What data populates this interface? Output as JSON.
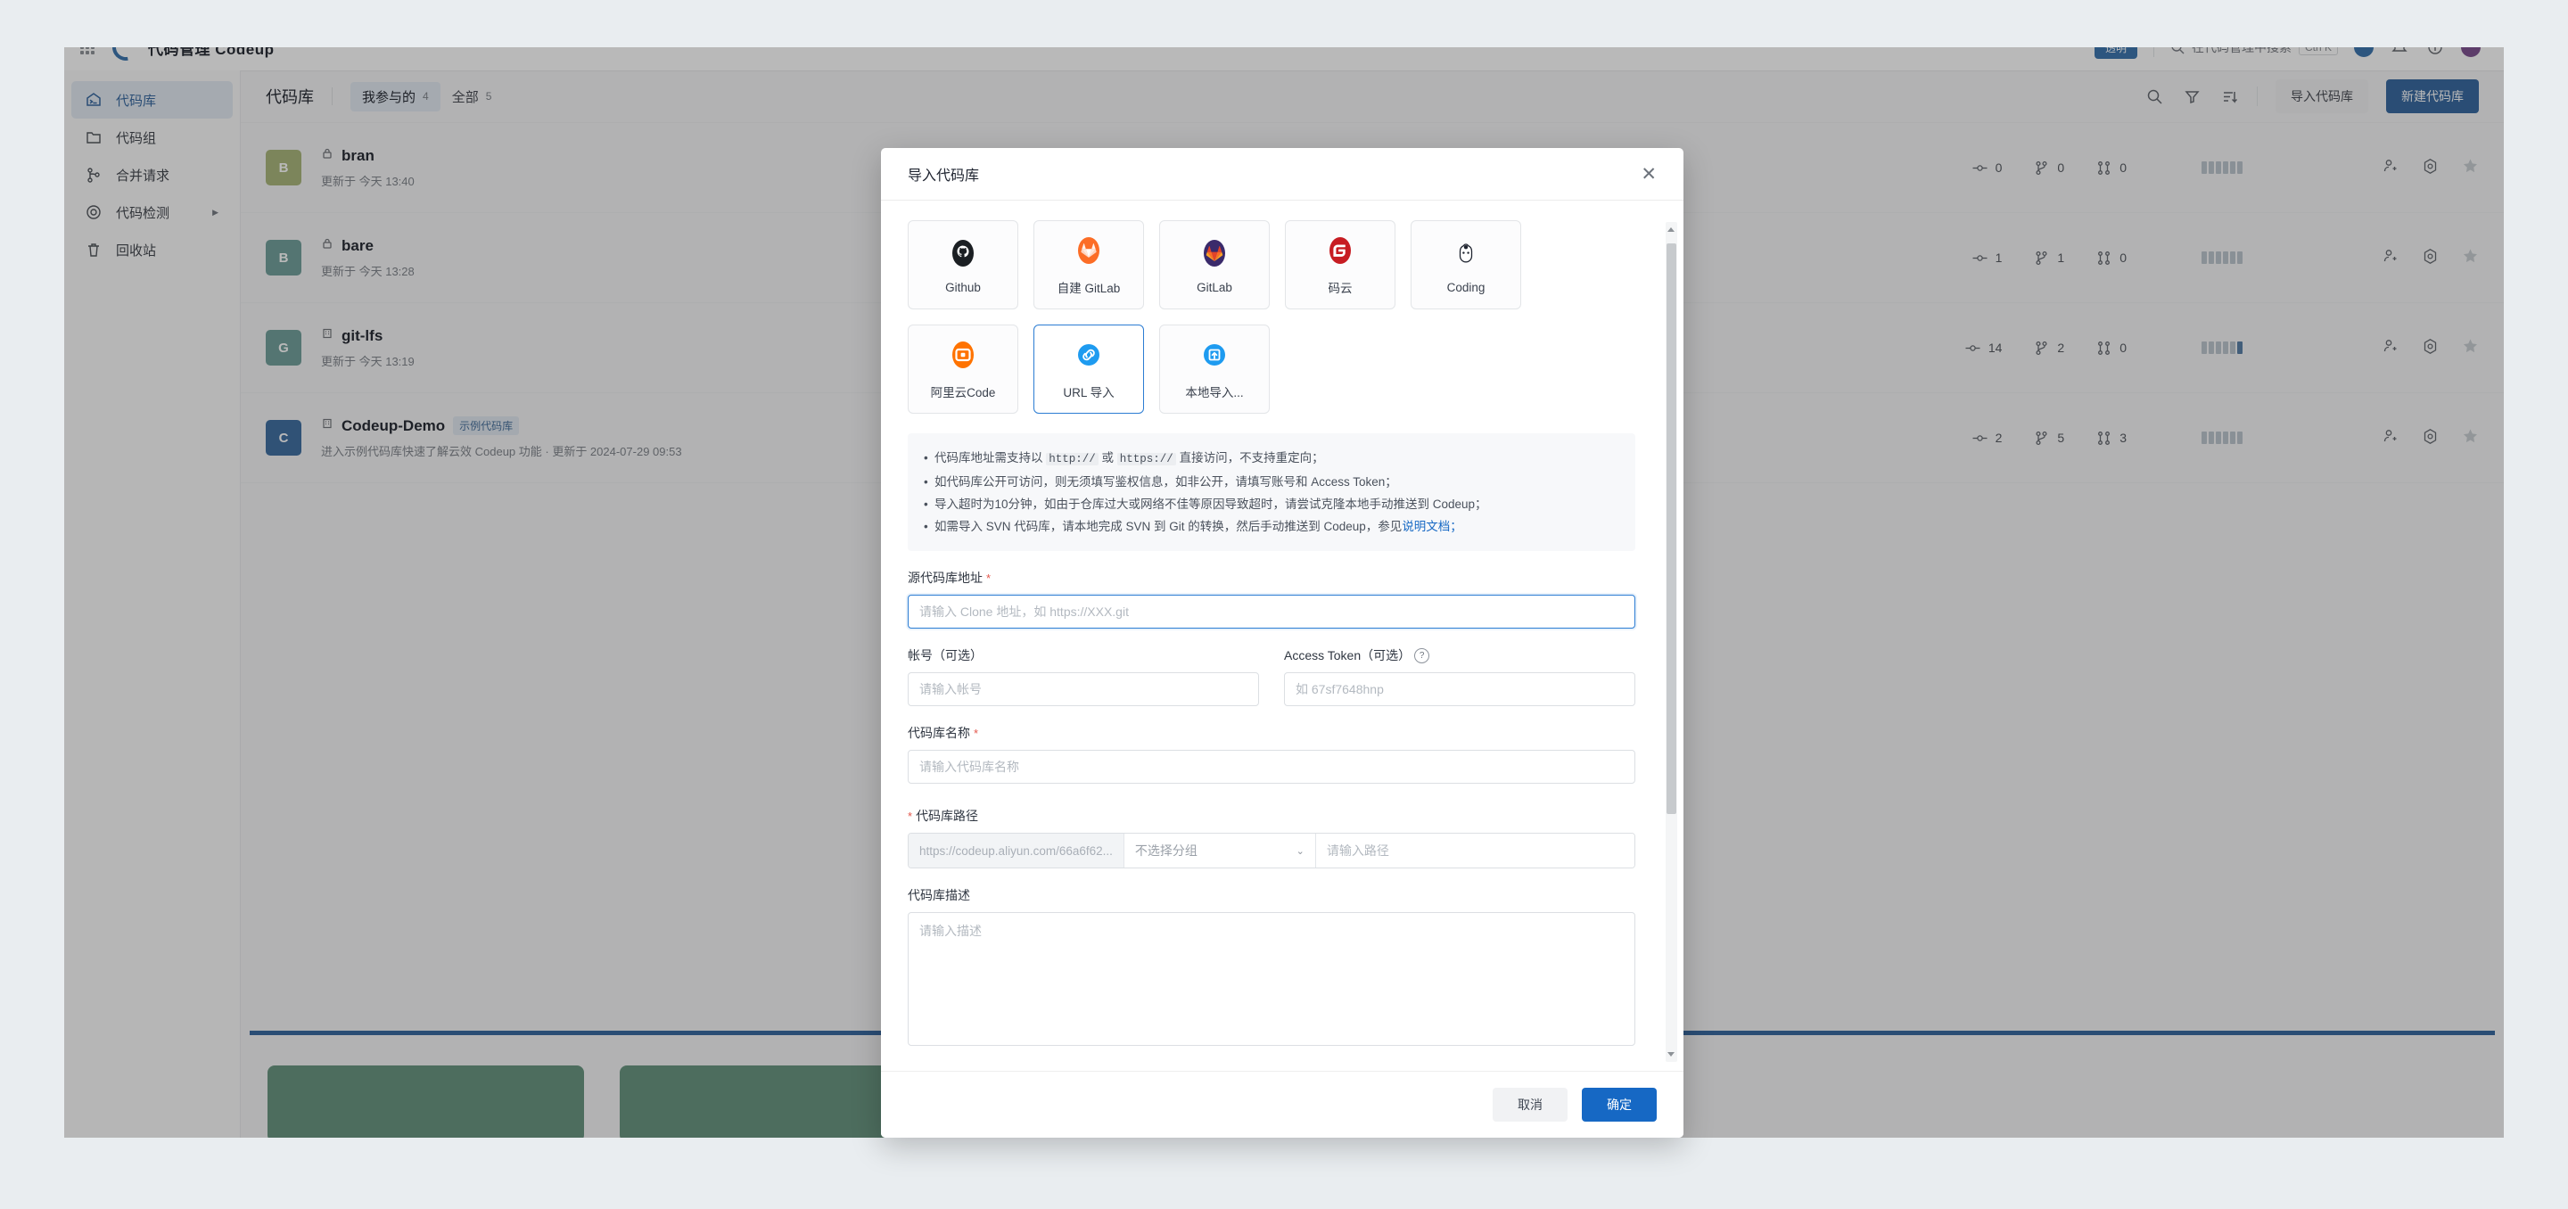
{
  "topbar": {
    "brand": "代码管理 Codeup",
    "badge": "透明",
    "search_placeholder": "在代码管理中搜索",
    "search_kbd": "Ctrl K"
  },
  "sidebar": {
    "items": [
      {
        "label": "代码库",
        "icon": "repository-icon",
        "active": true,
        "caret": false
      },
      {
        "label": "代码组",
        "icon": "folder-icon",
        "active": false,
        "caret": false
      },
      {
        "label": "合并请求",
        "icon": "merge-request-icon",
        "active": false,
        "caret": false
      },
      {
        "label": "代码检测",
        "icon": "code-scan-icon",
        "active": false,
        "caret": true
      },
      {
        "label": "回收站",
        "icon": "trash-icon",
        "active": false,
        "caret": false
      }
    ]
  },
  "content": {
    "title": "代码库",
    "tabs": [
      {
        "label": "我参与的",
        "count": "4",
        "active": true
      },
      {
        "label": "全部",
        "count": "5",
        "active": false
      }
    ],
    "toolbar": {
      "search_icon": "search-icon",
      "filter_icon": "filter-icon",
      "sort_icon": "sort-icon",
      "import_label": "导入代码库",
      "create_label": "新建代码库"
    },
    "repos": [
      {
        "initial": "B",
        "color": "#a4b957",
        "name": "bran",
        "visibility": "private",
        "tag": "",
        "sub": "更新于 今天 13:40",
        "commits": "0",
        "branches": "0",
        "mrs": "0",
        "bars": 6,
        "hi": 0
      },
      {
        "initial": "B",
        "color": "#56a49b",
        "name": "bare",
        "visibility": "private",
        "tag": "",
        "sub": "更新于 今天 13:28",
        "commits": "1",
        "branches": "1",
        "mrs": "0",
        "bars": 6,
        "hi": 0
      },
      {
        "initial": "G",
        "color": "#56a49b",
        "name": "git-lfs",
        "visibility": "internal",
        "tag": "",
        "sub": "更新于 今天 13:19",
        "commits": "14",
        "branches": "2",
        "mrs": "0",
        "bars": 6,
        "hi": 1
      },
      {
        "initial": "C",
        "color": "#1f6fc4",
        "name": "Codeup-Demo",
        "visibility": "internal",
        "tag": "示例代码库",
        "sub": "进入示例代码库快速了解云效 Codeup 功能 ·  更新于 2024-07-29 09:53",
        "commits": "2",
        "branches": "5",
        "mrs": "3",
        "bars": 6,
        "hi": 0
      }
    ]
  },
  "modal": {
    "title": "导入代码库",
    "close_icon": "close-icon",
    "sources": [
      {
        "label": "Github",
        "icon": "github-logo",
        "selected": false
      },
      {
        "label": "自建 GitLab",
        "icon": "gitlab-fox-logo",
        "selected": false
      },
      {
        "label": "GitLab",
        "icon": "gitlab-logo",
        "selected": false
      },
      {
        "label": "码云",
        "icon": "gitee-logo",
        "selected": false
      },
      {
        "label": "Coding",
        "icon": "coding-logo",
        "selected": false
      },
      {
        "label": "阿里云Code",
        "icon": "aliyun-code-logo",
        "selected": false
      },
      {
        "label": "URL 导入",
        "icon": "link-icon",
        "selected": true
      },
      {
        "label": "本地导入...",
        "icon": "upload-icon",
        "selected": false
      }
    ],
    "notice": [
      {
        "parts": [
          {
            "t": "代码库地址需支持以 ",
            "k": "text"
          },
          {
            "t": "http://",
            "k": "code"
          },
          {
            "t": " 或 ",
            "k": "text"
          },
          {
            "t": "https://",
            "k": "code"
          },
          {
            "t": " 直接访问，不支持重定向；",
            "k": "text"
          }
        ]
      },
      {
        "parts": [
          {
            "t": "如代码库公开可访问，则无须填写鉴权信息，如非公开，请填写账号和 Access Token；",
            "k": "text"
          }
        ]
      },
      {
        "parts": [
          {
            "t": "导入超时为10分钟，如由于仓库过大或网络不佳等原因导致超时，请尝试克隆本地手动推送到 Codeup；",
            "k": "text"
          }
        ]
      },
      {
        "parts": [
          {
            "t": "如需导入 SVN 代码库，请本地完成 SVN 到 Git 的转换，然后手动推送到 Codeup，参见",
            "k": "text"
          },
          {
            "t": "说明文档；",
            "k": "link"
          }
        ]
      }
    ],
    "fields": {
      "source_url_label": "源代码库地址",
      "source_url_required": "*",
      "source_url_value": "",
      "source_url_placeholder": "请输入 Clone 地址，如 https://XXX.git",
      "account_label": "帐号（可选）",
      "account_value": "",
      "account_placeholder": "请输入帐号",
      "token_label": "Access Token（可选）",
      "token_help_icon": "help-icon",
      "token_value": "",
      "token_placeholder": "如 67sf7648hnp",
      "repo_name_label": "代码库名称",
      "repo_name_required": "*",
      "repo_name_value": "",
      "repo_name_placeholder": "请输入代码库名称",
      "repo_path_label": "代码库路径",
      "repo_path_required": "*",
      "repo_path_prefix": "https://codeup.aliyun.com/66a6f62...",
      "repo_path_group_selected": "不选择分组",
      "repo_path_group_caret": "chevron-down-icon",
      "repo_path_value": "",
      "repo_path_placeholder": "请输入路径",
      "repo_desc_label": "代码库描述",
      "repo_desc_value": "",
      "repo_desc_placeholder": "请输入描述"
    },
    "footer": {
      "cancel_label": "取消",
      "confirm_label": "确定"
    }
  },
  "colors": {
    "primary": "#1668c4",
    "accent_selected": "#2b7cd3",
    "required": "#e4574c",
    "link": "#1668c4"
  }
}
